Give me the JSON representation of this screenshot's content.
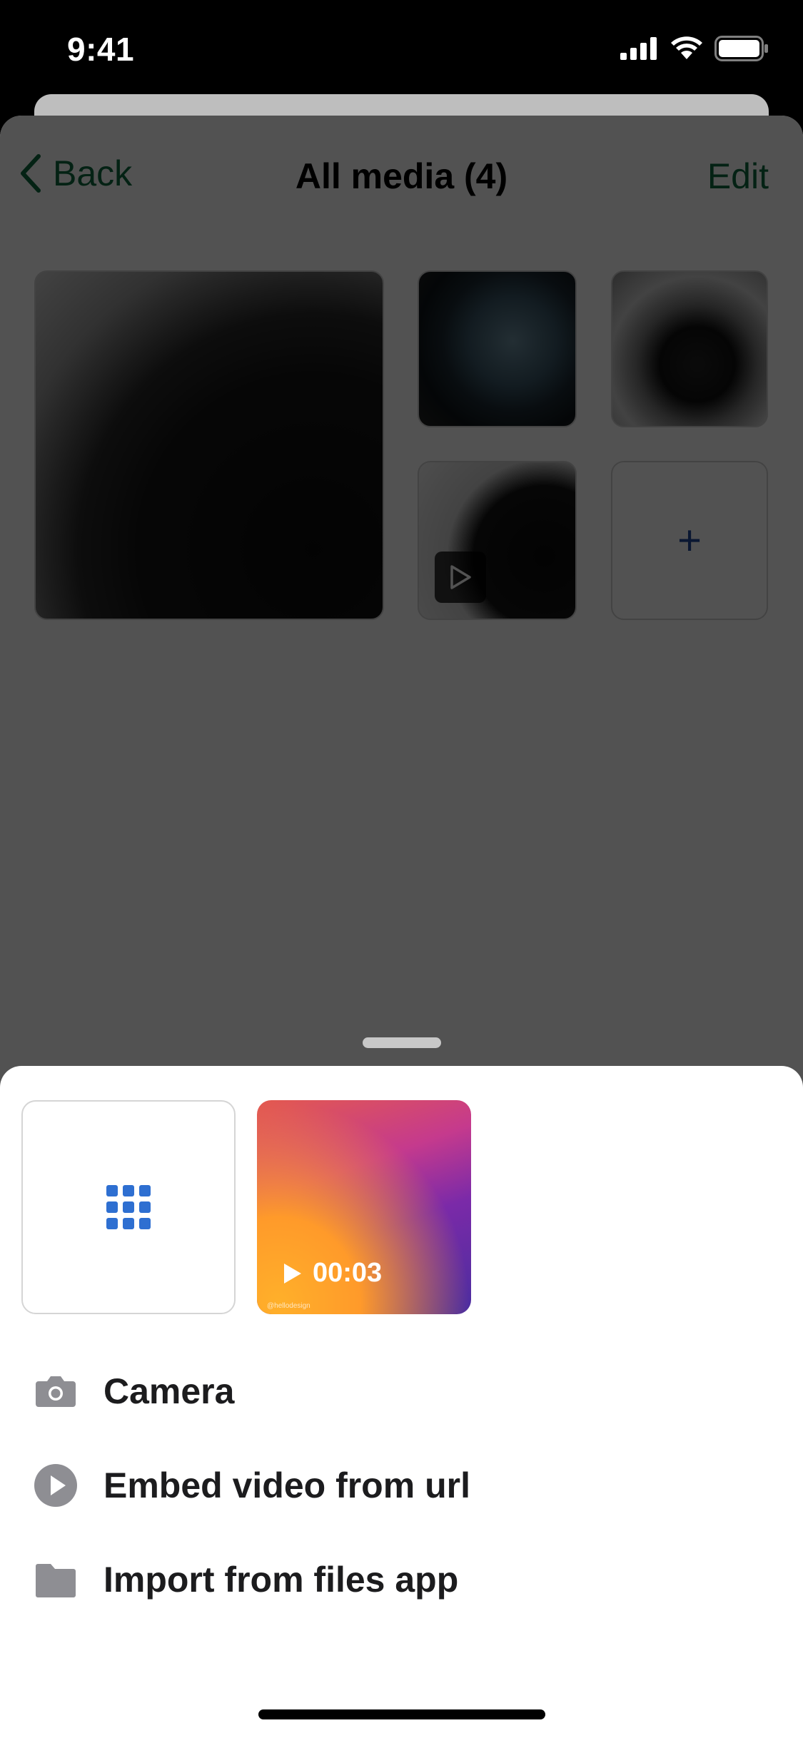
{
  "status_bar": {
    "time": "9:41"
  },
  "nav": {
    "back_label": "Back",
    "title": "All media (4)",
    "edit_label": "Edit"
  },
  "media": {
    "add_symbol": "+",
    "video_icon": "play-outline-icon"
  },
  "sheet": {
    "picker": {
      "grid_icon": "grid-icon",
      "video_duration": "00:03",
      "watermark": "@hellodesign"
    },
    "menu": [
      {
        "icon": "camera-icon",
        "label": "Camera"
      },
      {
        "icon": "play-circle-icon",
        "label": "Embed video from url"
      },
      {
        "icon": "folder-icon",
        "label": "Import from files app"
      }
    ]
  },
  "colors": {
    "accent_green": "#0f6b3f",
    "accent_blue": "#2e6fd1",
    "icon_gray": "#8e8e93"
  }
}
